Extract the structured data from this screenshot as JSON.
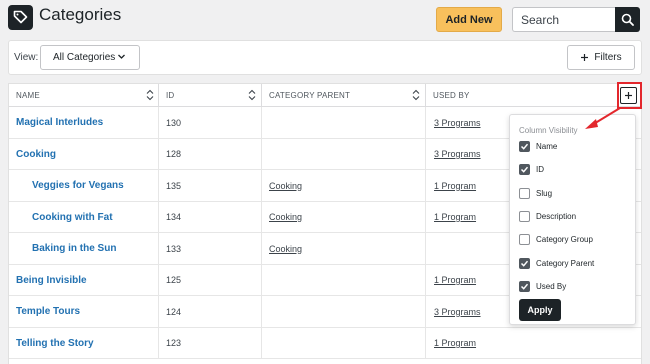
{
  "header": {
    "title": "Categories",
    "add_new_label": "Add New",
    "search_placeholder": "Search"
  },
  "toolbar": {
    "view_label": "View:",
    "view_value": "All Categories",
    "filters_label": "Filters"
  },
  "table": {
    "columns": [
      "NAME",
      "ID",
      "CATEGORY PARENT",
      "USED BY"
    ],
    "rows": [
      {
        "name": "Magical Interludes",
        "id": "130",
        "parent": "",
        "used_by": "3 Programs",
        "child": false
      },
      {
        "name": "Cooking",
        "id": "128",
        "parent": "",
        "used_by": "3 Programs",
        "child": false
      },
      {
        "name": "Veggies for Vegans",
        "id": "135",
        "parent": "Cooking",
        "used_by": "1 Program",
        "child": true
      },
      {
        "name": "Cooking with Fat",
        "id": "134",
        "parent": "Cooking",
        "used_by": "1 Program",
        "child": true
      },
      {
        "name": "Baking in the Sun",
        "id": "133",
        "parent": "Cooking",
        "used_by": "",
        "child": true
      },
      {
        "name": "Being Invisible",
        "id": "125",
        "parent": "",
        "used_by": "1 Program",
        "child": false
      },
      {
        "name": "Temple Tours",
        "id": "124",
        "parent": "",
        "used_by": "3 Programs",
        "child": false
      },
      {
        "name": "Telling the Story",
        "id": "123",
        "parent": "",
        "used_by": "1 Program",
        "child": false
      }
    ]
  },
  "column_visibility": {
    "title": "Column Visibility",
    "options": [
      {
        "label": "Name",
        "checked": true
      },
      {
        "label": "ID",
        "checked": true
      },
      {
        "label": "Slug",
        "checked": false
      },
      {
        "label": "Description",
        "checked": false
      },
      {
        "label": "Category Group",
        "checked": false
      },
      {
        "label": "Category Parent",
        "checked": true
      },
      {
        "label": "Used By",
        "checked": true
      }
    ],
    "apply_label": "Apply"
  },
  "colors": {
    "accent": "#f8c05c",
    "link": "#2271b1",
    "dark": "#1d2327",
    "highlight": "#e3272d"
  }
}
